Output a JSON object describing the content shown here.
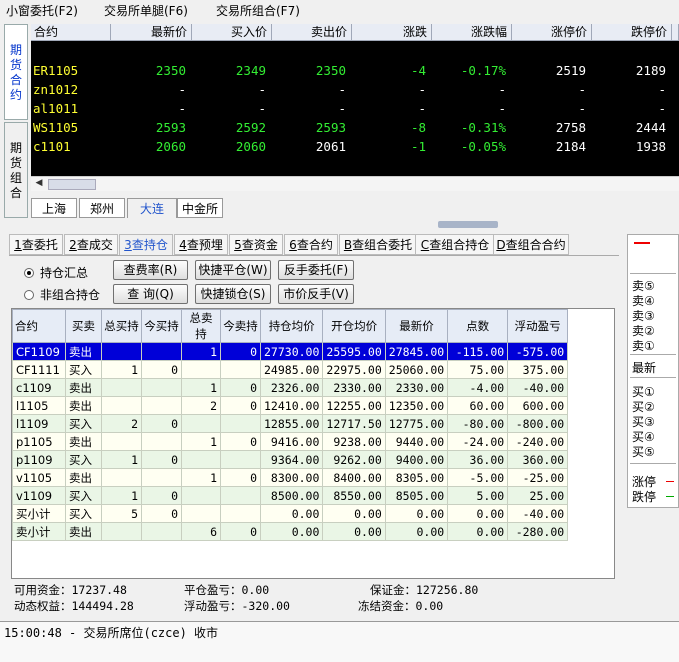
{
  "menu": [
    "小窗委托(F2)",
    "交易所单腿(F6)",
    "交易所组合(F7)"
  ],
  "side_tabs": {
    "futures": "期货合约",
    "combo": "期货组合"
  },
  "quote": {
    "headers": [
      "合约",
      "最新价",
      "买入价",
      "卖出价",
      "涨跌",
      "涨跌幅",
      "涨停价",
      "跌停价"
    ],
    "rows": [
      {
        "name": "ER1105",
        "last": "2350",
        "bid": "2349",
        "ask": "2350",
        "chg": "-4",
        "pct": "-0.17%",
        "up": "2519",
        "down": "2189"
      },
      {
        "name": "zn1012",
        "last": "-",
        "bid": "-",
        "ask": "-",
        "chg": "-",
        "pct": "-",
        "up": "-",
        "down": "-"
      },
      {
        "name": "al1011",
        "last": "-",
        "bid": "-",
        "ask": "-",
        "chg": "-",
        "pct": "-",
        "up": "-",
        "down": "-"
      },
      {
        "name": "WS1105",
        "last": "2593",
        "bid": "2592",
        "ask": "2593",
        "chg": "-8",
        "pct": "-0.31%",
        "up": "2758",
        "down": "2444"
      },
      {
        "name": "c1101",
        "last": "2060",
        "bid": "2060",
        "ask": "2061",
        "chg": "-1",
        "pct": "-0.05%",
        "up": "2184",
        "down": "1938"
      }
    ]
  },
  "exchanges": [
    "上海",
    "郑州",
    "大连",
    "中金所"
  ],
  "func_tabs": [
    {
      "key": "1",
      "label": "查委托"
    },
    {
      "key": "2",
      "label": "查成交"
    },
    {
      "key": "3",
      "label": "查持仓"
    },
    {
      "key": "4",
      "label": "查预埋"
    },
    {
      "key": "5",
      "label": "查资金"
    },
    {
      "key": "6",
      "label": "查合约"
    },
    {
      "key": "B",
      "label": "查组合委托"
    },
    {
      "key": "C",
      "label": "查组合持仓"
    },
    {
      "key": "D",
      "label": "查组合合约"
    }
  ],
  "radios": {
    "summary": "持仓汇总",
    "non_combo": "非组合持仓"
  },
  "buttons": {
    "fee_rate": "查费率(R)",
    "quick_close": "快捷平仓(W)",
    "reverse_order": "反手委托(F)",
    "query": "查 询(Q)",
    "quick_lock": "快捷锁仓(S)",
    "market_reverse": "市价反手(V)"
  },
  "positions": {
    "headers": [
      "合约",
      "买卖",
      "总买持",
      "今买持",
      "总卖持",
      "今卖持",
      "持仓均价",
      "开仓均价",
      "最新价",
      "点数",
      "浮动盈亏"
    ],
    "rows": [
      [
        "CF1109",
        "卖出",
        "",
        "",
        "1",
        "0",
        "27730.00",
        "25595.00",
        "27845.00",
        "-115.00",
        "-575.00"
      ],
      [
        "CF1111",
        "买入",
        "1",
        "0",
        "",
        "",
        "24985.00",
        "22975.00",
        "25060.00",
        "75.00",
        "375.00"
      ],
      [
        "c1109",
        "卖出",
        "",
        "",
        "1",
        "0",
        "2326.00",
        "2330.00",
        "2330.00",
        "-4.00",
        "-40.00"
      ],
      [
        "l1105",
        "卖出",
        "",
        "",
        "2",
        "0",
        "12410.00",
        "12255.00",
        "12350.00",
        "60.00",
        "600.00"
      ],
      [
        "l1109",
        "买入",
        "2",
        "0",
        "",
        "",
        "12855.00",
        "12717.50",
        "12775.00",
        "-80.00",
        "-800.00"
      ],
      [
        "p1105",
        "卖出",
        "",
        "",
        "1",
        "0",
        "9416.00",
        "9238.00",
        "9440.00",
        "-24.00",
        "-240.00"
      ],
      [
        "p1109",
        "买入",
        "1",
        "0",
        "",
        "",
        "9364.00",
        "9262.00",
        "9400.00",
        "36.00",
        "360.00"
      ],
      [
        "v1105",
        "卖出",
        "",
        "",
        "1",
        "0",
        "8300.00",
        "8400.00",
        "8305.00",
        "-5.00",
        "-25.00"
      ],
      [
        "v1109",
        "买入",
        "1",
        "0",
        "",
        "",
        "8500.00",
        "8550.00",
        "8505.00",
        "5.00",
        "25.00"
      ],
      [
        "买小计",
        "买入",
        "5",
        "0",
        "",
        "",
        "0.00",
        "0.00",
        "0.00",
        "0.00",
        "-40.00"
      ],
      [
        "卖小计",
        "卖出",
        "",
        "",
        "6",
        "0",
        "0.00",
        "0.00",
        "0.00",
        "0.00",
        "-280.00"
      ]
    ]
  },
  "summary": {
    "available": "可用资金：17237.48",
    "close_pnl": "平仓盈亏：0.00",
    "margin": "保证金：127256.80",
    "equity": "动态权益：144494.28",
    "float_pnl": "浮动盈亏：-320.00",
    "frozen": "冻结资金：0.00"
  },
  "depth": {
    "sells": [
      "卖⑤",
      "卖④",
      "卖③",
      "卖②",
      "卖①"
    ],
    "last": "最新",
    "buys": [
      "买①",
      "买②",
      "买③",
      "买④",
      "买⑤"
    ],
    "limit_up": "涨停",
    "limit_down": "跌停"
  },
  "status": "15:00:48 - 交易所席位(czce) 收市",
  "colors": {
    "quote_bg": "#000000",
    "quote_name": "#ffff33",
    "quote_green": "#33ee33",
    "selected_row": "#0000d8",
    "accent": "#2255cc"
  }
}
